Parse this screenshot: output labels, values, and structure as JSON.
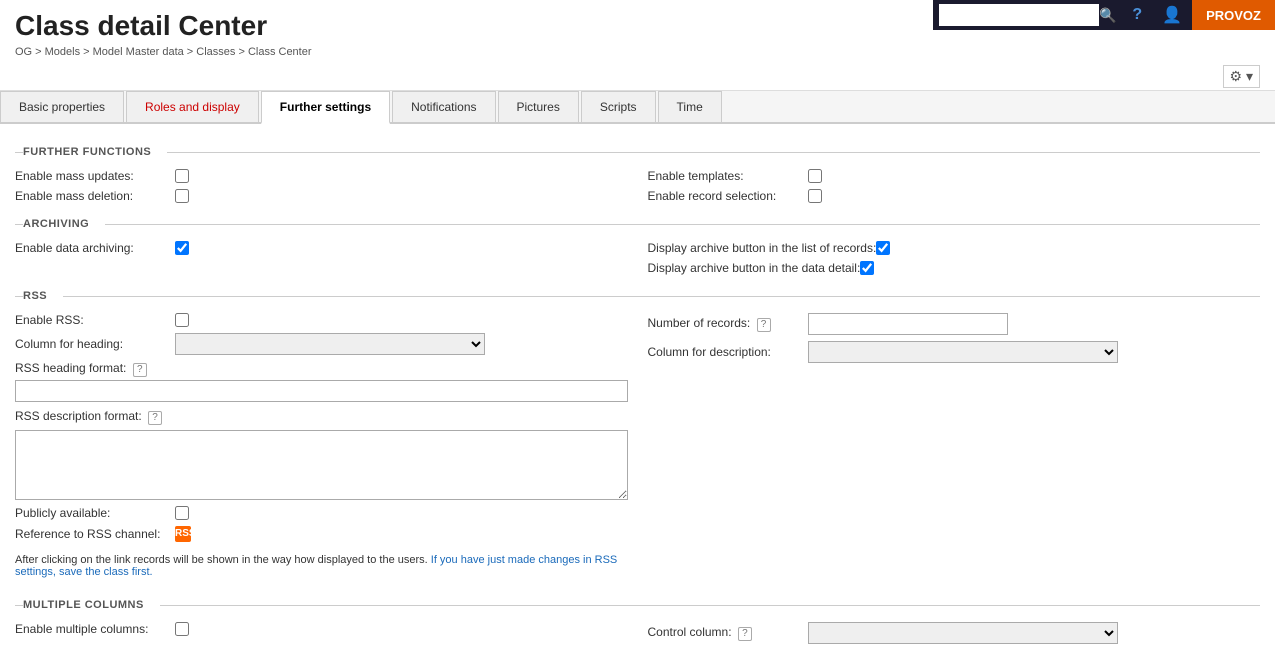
{
  "page": {
    "title": "Class detail Center",
    "breadcrumb": "OG > Models > Model Master data > Classes > Class Center"
  },
  "header": {
    "search_placeholder": "",
    "provoz_label": "PROVOZ"
  },
  "tabs": [
    {
      "id": "basic-properties",
      "label": "Basic properties",
      "active": false
    },
    {
      "id": "roles-and-display",
      "label": "Roles and display",
      "active": false
    },
    {
      "id": "further-settings",
      "label": "Further settings",
      "active": true
    },
    {
      "id": "notifications",
      "label": "Notifications",
      "active": false
    },
    {
      "id": "pictures",
      "label": "Pictures",
      "active": false
    },
    {
      "id": "scripts",
      "label": "Scripts",
      "active": false
    },
    {
      "id": "time",
      "label": "Time",
      "active": false
    }
  ],
  "sections": {
    "further_functions": {
      "title": "FURTHER FUNCTIONS",
      "fields": {
        "enable_mass_updates": "Enable mass updates:",
        "enable_mass_deletion": "Enable mass deletion:",
        "enable_templates": "Enable templates:",
        "enable_record_selection": "Enable record selection:"
      }
    },
    "archiving": {
      "title": "ARCHIVING",
      "fields": {
        "enable_data_archiving": "Enable data archiving:",
        "display_archive_list": "Display archive button in the list of records:",
        "display_archive_detail": "Display archive button in the data detail:"
      }
    },
    "rss": {
      "title": "RSS",
      "fields": {
        "enable_rss": "Enable RSS:",
        "column_for_heading": "Column for heading:",
        "rss_heading_format": "RSS heading format:",
        "rss_description_format": "RSS description format:",
        "publicly_available": "Publicly available:",
        "reference_to_rss": "Reference to RSS channel:",
        "number_of_records": "Number of records:",
        "column_for_description": "Column for description:"
      },
      "info_text": "After clicking on the link records will be shown in the way how displayed to the users. If you have just made changes in RSS settings, save the class first."
    },
    "multiple_columns": {
      "title": "MULTIPLE COLUMNS",
      "fields": {
        "enable_multiple_columns": "Enable multiple columns:",
        "control_column": "Control column:"
      }
    }
  },
  "icons": {
    "search": "🔍",
    "help": "?",
    "user": "👤",
    "gear": "⚙",
    "chevron_down": "▾",
    "rss": "RSS",
    "help_small": "?"
  }
}
